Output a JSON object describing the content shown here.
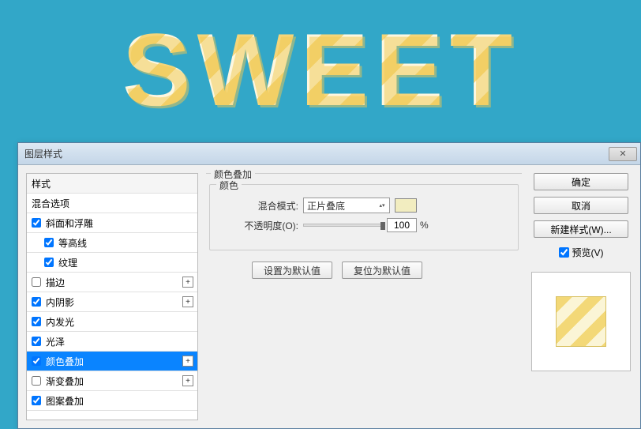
{
  "dialog": {
    "title": "图层样式",
    "close_label": "✕"
  },
  "styles_list": {
    "header": "样式",
    "blend_options": "混合选项",
    "items": [
      {
        "label": "斜面和浮雕",
        "checked": true,
        "expandable": false,
        "sub": false
      },
      {
        "label": "等高线",
        "checked": true,
        "expandable": false,
        "sub": true
      },
      {
        "label": "纹理",
        "checked": true,
        "expandable": false,
        "sub": true
      },
      {
        "label": "描边",
        "checked": false,
        "expandable": true,
        "sub": false
      },
      {
        "label": "内阴影",
        "checked": true,
        "expandable": true,
        "sub": false
      },
      {
        "label": "内发光",
        "checked": true,
        "expandable": false,
        "sub": false
      },
      {
        "label": "光泽",
        "checked": true,
        "expandable": false,
        "sub": false
      },
      {
        "label": "颜色叠加",
        "checked": true,
        "expandable": true,
        "sub": false,
        "selected": true
      },
      {
        "label": "渐变叠加",
        "checked": false,
        "expandable": true,
        "sub": false
      },
      {
        "label": "图案叠加",
        "checked": true,
        "expandable": false,
        "sub": false
      }
    ]
  },
  "options": {
    "section_title": "颜色叠加",
    "group_label": "颜色",
    "blend_mode_label": "混合模式:",
    "blend_mode_value": "正片叠底",
    "opacity_label": "不透明度(O):",
    "opacity_value": "100",
    "opacity_unit": "%",
    "color_swatch": "#f2edc0",
    "default_btn": "设置为默认值",
    "reset_btn": "复位为默认值"
  },
  "right": {
    "ok": "确定",
    "cancel": "取消",
    "new_style": "新建样式(W)...",
    "preview_label": "预览(V)",
    "preview_checked": true
  },
  "art_text": "SWEET"
}
